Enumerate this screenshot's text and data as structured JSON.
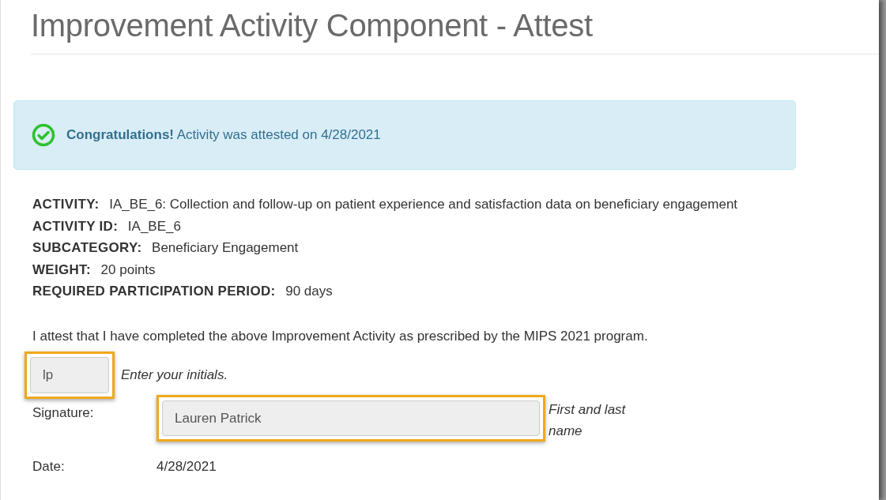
{
  "page_title": "Improvement Activity Component - Attest",
  "alert": {
    "kind": "success",
    "heading": "Congratulations!",
    "message": "Activity was attested on 4/28/2021"
  },
  "details": [
    {
      "label": "ACTIVITY:",
      "value": "IA_BE_6: Collection and follow-up on patient experience and satisfaction data on beneficiary engagement"
    },
    {
      "label": "ACTIVITY ID:",
      "value": "IA_BE_6"
    },
    {
      "label": "SUBCATEGORY:",
      "value": "Beneficiary Engagement"
    },
    {
      "label": "WEIGHT:",
      "value": "20 points"
    },
    {
      "label": "REQUIRED PARTICIPATION PERIOD:",
      "value": "90 days"
    }
  ],
  "attestation_text": "I attest that I have completed the above Improvement Activity as prescribed by the MIPS 2021 program.",
  "initials": {
    "value": "lp",
    "hint": "Enter your initials.",
    "highlighted": true
  },
  "signature": {
    "label": "Signature:",
    "value": "Lauren Patrick",
    "hint": "First and last name",
    "highlighted": true
  },
  "date": {
    "label": "Date:",
    "value": "4/28/2021"
  }
}
